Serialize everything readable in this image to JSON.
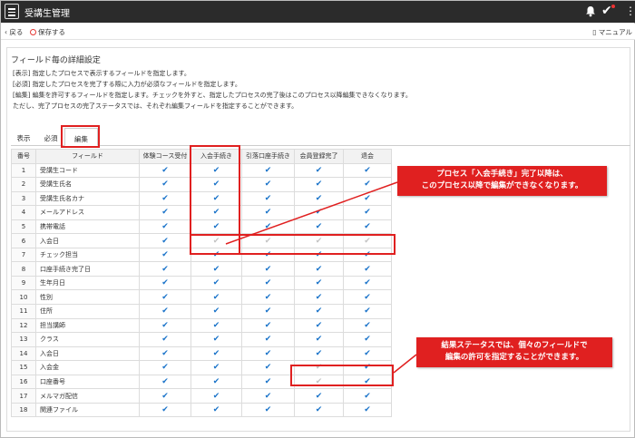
{
  "app": {
    "title": "受講生管理"
  },
  "actions": {
    "back": "戻る",
    "save": "保存する",
    "manual": "マニュアル"
  },
  "section": {
    "title": "フィールド毎の詳細設定",
    "descriptions": [
      "[表示] 指定したプロセスで表示するフィールドを指定します。",
      "[必須] 指定したプロセスを完了する際に入力が必須なフィールドを指定します。",
      "[編集] 編集を許可するフィールドを指定します。チェックを外すと、指定したプロセスの完了後はこのプロセス以降編集できなくなります。",
      "ただし、完了プロセスの完了ステータスでは、それぞれ編集フィールドを指定することができます。"
    ]
  },
  "tabs": [
    {
      "label": "表示"
    },
    {
      "label": "必須"
    },
    {
      "label": "編集"
    }
  ],
  "table": {
    "headers": [
      "番号",
      "フィールド",
      "体験コース受付",
      "入会手続き",
      "引落口座手続き",
      "会員登録完了",
      "退会"
    ],
    "rows": [
      {
        "num": "1",
        "field": "受講生コード",
        "checks": [
          1,
          1,
          1,
          1,
          1
        ]
      },
      {
        "num": "2",
        "field": "受講生氏名",
        "checks": [
          1,
          1,
          1,
          1,
          1
        ]
      },
      {
        "num": "3",
        "field": "受講生氏名カナ",
        "checks": [
          1,
          1,
          1,
          1,
          1
        ]
      },
      {
        "num": "4",
        "field": "メールアドレス",
        "checks": [
          1,
          1,
          1,
          1,
          1
        ]
      },
      {
        "num": "5",
        "field": "携帯電話",
        "checks": [
          1,
          1,
          1,
          1,
          1
        ]
      },
      {
        "num": "6",
        "field": "入会日",
        "checks": [
          1,
          0,
          0,
          0,
          0
        ]
      },
      {
        "num": "7",
        "field": "チェック担当",
        "checks": [
          1,
          1,
          1,
          1,
          1
        ]
      },
      {
        "num": "8",
        "field": "口座手続き完了日",
        "checks": [
          1,
          1,
          1,
          1,
          1
        ]
      },
      {
        "num": "9",
        "field": "生年月日",
        "checks": [
          1,
          1,
          1,
          1,
          1
        ]
      },
      {
        "num": "10",
        "field": "性別",
        "checks": [
          1,
          1,
          1,
          1,
          1
        ]
      },
      {
        "num": "11",
        "field": "住所",
        "checks": [
          1,
          1,
          1,
          1,
          1
        ]
      },
      {
        "num": "12",
        "field": "担当講師",
        "checks": [
          1,
          1,
          1,
          1,
          1
        ]
      },
      {
        "num": "13",
        "field": "クラス",
        "checks": [
          1,
          1,
          1,
          1,
          1
        ]
      },
      {
        "num": "14",
        "field": "入会日",
        "checks": [
          1,
          1,
          1,
          1,
          1
        ]
      },
      {
        "num": "15",
        "field": "入会金",
        "checks": [
          1,
          1,
          1,
          0,
          1
        ]
      },
      {
        "num": "16",
        "field": "口座番号",
        "checks": [
          1,
          1,
          1,
          0,
          1
        ]
      },
      {
        "num": "17",
        "field": "メルマガ配信",
        "checks": [
          1,
          1,
          1,
          1,
          1
        ]
      },
      {
        "num": "18",
        "field": "関連ファイル",
        "checks": [
          1,
          1,
          1,
          1,
          1
        ]
      }
    ]
  },
  "callouts": {
    "process": {
      "line1": "プロセス「入会手続き」完了以降は、",
      "line2": "このプロセス以降で編集ができなくなります。"
    },
    "status": {
      "line1": "結果ステータスでは、個々のフィールドで",
      "line2": "編集の許可を指定することができます。"
    }
  },
  "colors": {
    "topbar": "#2b2b2b",
    "check_on": "#1a73c9",
    "check_off": "#c4c4c4",
    "highlight": "#e02020"
  },
  "icons": {
    "check": "✔"
  }
}
